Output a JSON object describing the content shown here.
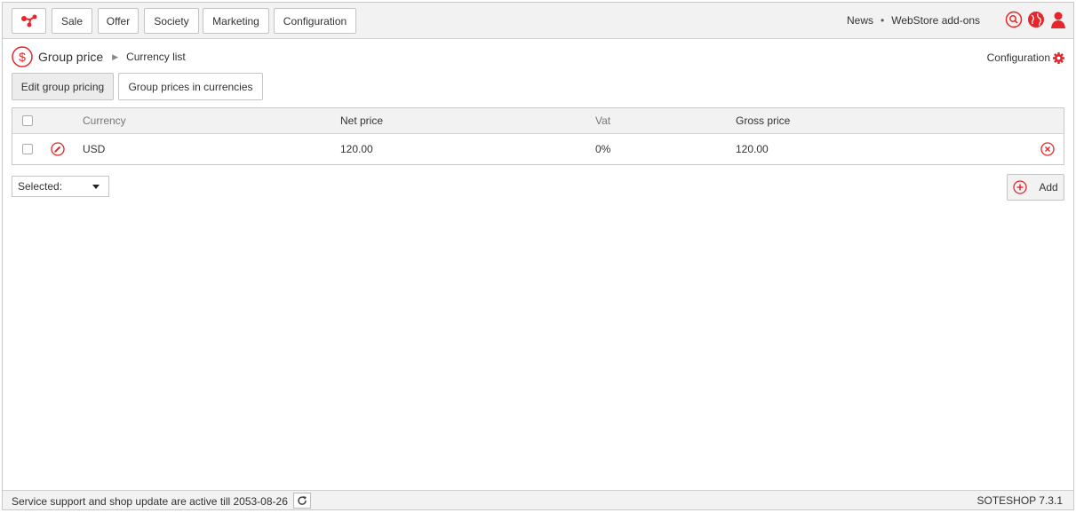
{
  "nav": {
    "logo_icon": "share-nodes-icon",
    "items": [
      "Sale",
      "Offer",
      "Society",
      "Marketing",
      "Configuration"
    ],
    "links": [
      "News",
      "WebStore add-ons"
    ],
    "icons": [
      "search-icon",
      "globe-icon",
      "user-icon"
    ]
  },
  "breadcrumb": {
    "icon": "dollar-icon",
    "title": "Group price",
    "current": "Currency list"
  },
  "config_link": "Configuration",
  "tabs": [
    "Edit group pricing",
    "Group prices in currencies"
  ],
  "table": {
    "columns": [
      "Currency",
      "Net price",
      "Vat",
      "Gross price"
    ],
    "rows": [
      {
        "currency": "USD",
        "net_price": "120.00",
        "vat": "0%",
        "gross_price": "120.00"
      }
    ]
  },
  "actions": {
    "selected_label": "Selected:",
    "add_label": "Add"
  },
  "footer": {
    "support_text": "Service support and shop update are active till 2053-08-26",
    "version": "SOTESHOP 7.3.1"
  },
  "colors": {
    "accent": "#e5262b",
    "bar_bg": "#f2f2f2",
    "border": "#c9c9c9"
  }
}
